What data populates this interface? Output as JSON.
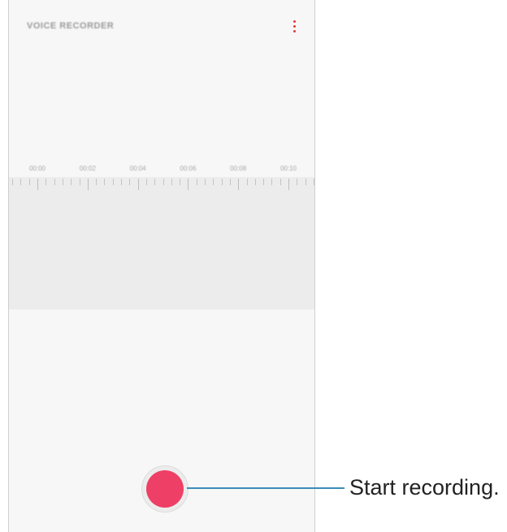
{
  "app": {
    "title": "VOICE RECORDER"
  },
  "toolbar": {
    "menu_icon": "more-vertical-icon"
  },
  "timeline": {
    "ticks": [
      "00:00",
      "00:02",
      "00:04",
      "00:06",
      "00:08",
      "00:10"
    ]
  },
  "record_button": {
    "icon": "record-icon",
    "color": "#ee3f66"
  },
  "callout": {
    "label": "Start recording."
  }
}
